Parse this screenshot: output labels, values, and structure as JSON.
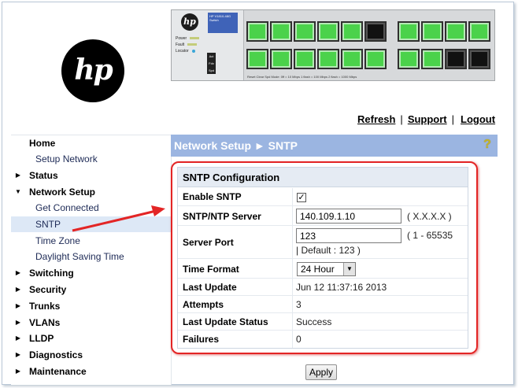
{
  "logo": {
    "text": "hp"
  },
  "switch_image": {
    "logo_text": "hp",
    "model_text": "HP V1810-48G Switch",
    "led_power": "Power",
    "led_fault": "Fault",
    "led_locator": "Locator",
    "btn_act": "Act",
    "btn_fdx": "Fdx",
    "btn_spd": "Spd",
    "legend": "Reset  Clear   Spd Mode: 0ff = 10 Mbps   1 flash = 100 Mbps   2 flash = 1000 Mbps"
  },
  "top_links": {
    "refresh": "Refresh",
    "support": "Support",
    "logout": "Logout",
    "separator": "|"
  },
  "sidebar": {
    "items": [
      {
        "label": "Home",
        "type": "top",
        "icon": ""
      },
      {
        "label": "Setup Network",
        "type": "sub"
      },
      {
        "label": "Status",
        "type": "top",
        "icon": "triangle-right"
      },
      {
        "label": "Network Setup",
        "type": "top",
        "icon": "triangle-down"
      },
      {
        "label": "Get Connected",
        "type": "sub"
      },
      {
        "label": "SNTP",
        "type": "sub",
        "active": true
      },
      {
        "label": "Time Zone",
        "type": "sub"
      },
      {
        "label": "Daylight Saving Time",
        "type": "sub"
      },
      {
        "label": "Switching",
        "type": "top",
        "icon": "triangle-right"
      },
      {
        "label": "Security",
        "type": "top",
        "icon": "triangle-right"
      },
      {
        "label": "Trunks",
        "type": "top",
        "icon": "triangle-right"
      },
      {
        "label": "VLANs",
        "type": "top",
        "icon": "triangle-right"
      },
      {
        "label": "LLDP",
        "type": "top",
        "icon": "triangle-right"
      },
      {
        "label": "Diagnostics",
        "type": "top",
        "icon": "triangle-right"
      },
      {
        "label": "Maintenance",
        "type": "top",
        "icon": "triangle-right"
      }
    ]
  },
  "content": {
    "breadcrumb": "Network Setup ► SNTP",
    "help_icon": "?"
  },
  "config": {
    "title": "SNTP Configuration",
    "enable_label": "Enable SNTP",
    "enable_checked": "✓",
    "server_label": "SNTP/NTP Server",
    "server_value": "140.109.1.10",
    "server_hint": "( X.X.X.X )",
    "port_label": "Server Port",
    "port_value": "123",
    "port_range": "( 1 - 65535",
    "port_default": "| Default : 123 )",
    "time_format_label": "Time Format",
    "time_format_value": "24 Hour",
    "last_update_label": "Last Update",
    "last_update_value": "Jun 12 11:37:16 2013",
    "attempts_label": "Attempts",
    "attempts_value": "3",
    "last_status_label": "Last Update Status",
    "last_status_value": "Success",
    "failures_label": "Failures",
    "failures_value": "0"
  },
  "buttons": {
    "apply": "Apply"
  },
  "colors": {
    "header_bg": "#9bb5e1",
    "active_nav_bg": "#dde8f6",
    "highlight_red": "#e32525",
    "port_green": "#4bd24b"
  }
}
